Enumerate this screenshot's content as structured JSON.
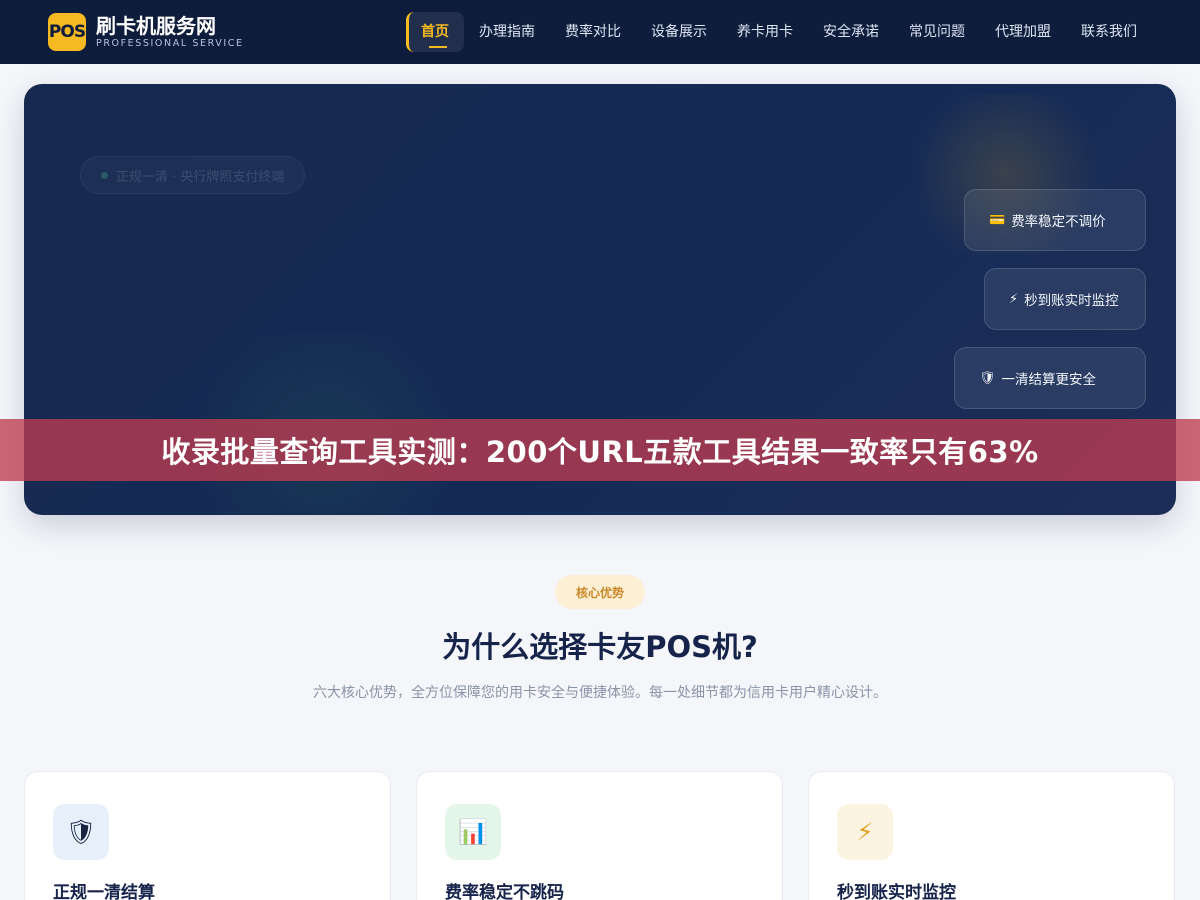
{
  "header": {
    "logo_badge": "POS",
    "site_title": "刷卡机服务网",
    "site_subtitle": "PROFESSIONAL SERVICE",
    "nav": [
      {
        "label": "首页",
        "active": true
      },
      {
        "label": "办理指南"
      },
      {
        "label": "费率对比"
      },
      {
        "label": "设备展示"
      },
      {
        "label": "养卡用卡"
      },
      {
        "label": "安全承诺"
      },
      {
        "label": "常见问题"
      },
      {
        "label": "代理加盟"
      },
      {
        "label": "联系我们"
      }
    ]
  },
  "hero": {
    "pill_text": "正规一清 · 央行牌照支付终端",
    "float_cards": [
      {
        "icon": "💳",
        "icon_name": "credit-card-icon",
        "label": "费率稳定不调价"
      },
      {
        "icon": "⚡",
        "icon_name": "lightning-icon",
        "label": "秒到账实时监控"
      },
      {
        "icon": "🛡",
        "icon_name": "shield-icon",
        "label": "一清结算更安全"
      }
    ]
  },
  "banner": {
    "text": "收录批量查询工具实测：200个URL五款工具结果一致率只有63%"
  },
  "advantages": {
    "tag": "核心优势",
    "title": "为什么选择卡友POS机?",
    "description": "六大核心优势，全方位保障您的用卡安全与便捷体验。每一处细节都为信用卡用户精心设计。",
    "cards": [
      {
        "icon": "🛡",
        "icon_name": "shield-icon",
        "title": "正规一清结算"
      },
      {
        "icon": "📊",
        "icon_name": "bar-chart-icon",
        "title": "费率稳定不跳码"
      },
      {
        "icon": "⚡",
        "icon_name": "lightning-icon",
        "title": "秒到账实时监控"
      }
    ]
  }
}
